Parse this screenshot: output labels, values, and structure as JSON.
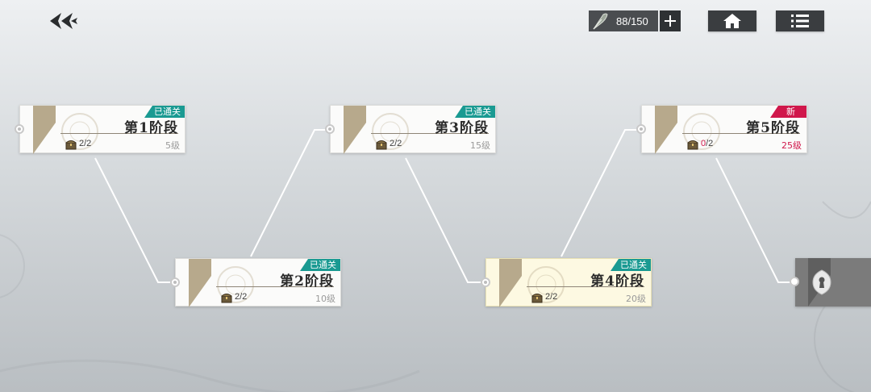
{
  "header": {
    "stamina_value": "88/150"
  },
  "stages": [
    {
      "title": "第1阶段",
      "badge": "已通关",
      "chests": "2/2",
      "level": "5级"
    },
    {
      "title": "第2阶段",
      "badge": "已通关",
      "chests": "2/2",
      "level": "10级"
    },
    {
      "title": "第3阶段",
      "badge": "已通关",
      "chests": "2/2",
      "level": "15级"
    },
    {
      "title": "第4阶段",
      "badge": "已通关",
      "chests": "2/2",
      "level": "20级"
    },
    {
      "title": "第5阶段",
      "badge": "新",
      "chests_obtained": "0",
      "chests_total": "/2",
      "level": "25级"
    }
  ],
  "colors": {
    "cleared_badge": "#1a9a92",
    "new_badge": "#d0174b",
    "button_dark": "#3a3d40"
  },
  "icons": {
    "back": "double-chevron-back-icon",
    "stamina": "quill-icon",
    "add": "plus-icon",
    "home": "home-icon",
    "menu": "list-menu-icon",
    "chest": "treasure-chest-icon",
    "lock": "keyhole-lock-icon"
  }
}
